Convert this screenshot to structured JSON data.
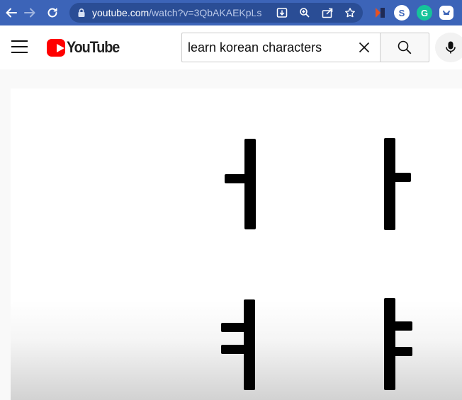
{
  "browser": {
    "url_host": "youtube.com",
    "url_path": "/watch?v=3QbAKAEKpLs",
    "extensions": [
      {
        "name": "s-extension-icon",
        "letter": "S",
        "color": "#ffffff",
        "fg": "#3c64b8"
      },
      {
        "name": "grammarly-icon",
        "letter": "G",
        "color": "#15c39a",
        "fg": "#ffffff"
      }
    ]
  },
  "youtube": {
    "logo_text": "YouTube",
    "search": {
      "value": "learn korean characters"
    }
  },
  "video": {
    "glyphs": [
      "ㅓ",
      "ㅏ",
      "ㅕ",
      "ㅑ"
    ]
  }
}
